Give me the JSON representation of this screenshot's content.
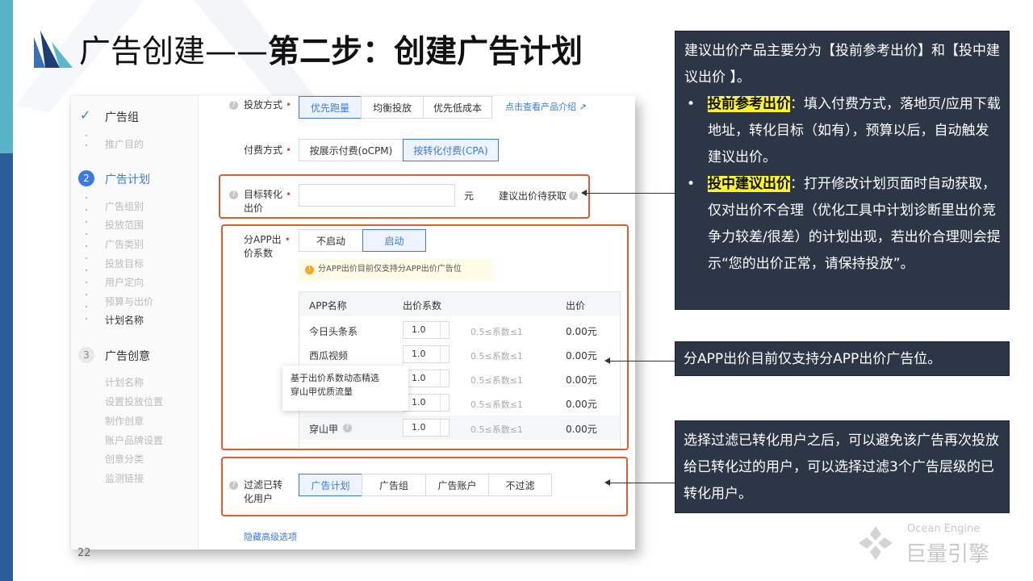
{
  "slide": {
    "title_normal": "广告创建——",
    "title_bold": "第二步：创建广告计划",
    "page_number": "22",
    "brand_en": "Ocean Engine",
    "brand_cn": "巨量引擎"
  },
  "sidebar": {
    "step1": {
      "label": "广告组",
      "sub": [
        "推广目的"
      ]
    },
    "step2": {
      "num": "2",
      "label": "广告计划",
      "sub": [
        "广告组别",
        "投放范围",
        "广告类别",
        "投放目标",
        "用户定向",
        "预算与出价",
        "计划名称"
      ]
    },
    "step3": {
      "num": "3",
      "label": "广告创意",
      "sub": [
        "计划名称",
        "设置投放位置",
        "制作创意",
        "账户品牌设置",
        "创意分类",
        "监测链接"
      ]
    }
  },
  "form": {
    "delivery_mode": {
      "label": "投放方式",
      "options": [
        "优先跑量",
        "均衡投放",
        "优先低成本"
      ],
      "selected": "优先跑量",
      "link": "点击查看产品介绍"
    },
    "pay_mode": {
      "label": "付费方式",
      "options": [
        "按展示付费(oCPM)",
        "按转化付费(CPA)"
      ],
      "selected": "按转化付费(CPA)"
    },
    "target_bid": {
      "label_line1": "目标转化",
      "label_line2": "出价",
      "value": "",
      "unit": "元",
      "suggest": "建议出价待获取"
    },
    "app_bid": {
      "label_line1": "分APP出",
      "label_line2": "价系数",
      "options": [
        "不启动",
        "启动"
      ],
      "selected": "启动",
      "notice": "分APP出价目前仅支持分APP出价广告位",
      "columns": [
        "APP名称",
        "出价系数",
        "出价"
      ],
      "rows": [
        {
          "app": "今日头条系",
          "coef": "1.0",
          "range": "0.5≤系数≤1",
          "price": "0.00元"
        },
        {
          "app": "西瓜视频",
          "coef": "1.0",
          "range": "0.5≤系数≤1",
          "price": "0.00元"
        },
        {
          "app": "",
          "coef": "1.0",
          "range": "0.5≤系数≤1",
          "price": "0.00元"
        },
        {
          "app": "",
          "coef": "1.0",
          "range": "0.5≤系数≤1",
          "price": "0.00元"
        },
        {
          "app": "穿山甲",
          "coef": "1.0",
          "range": "0.5≤系数≤1",
          "price": "0.00元"
        }
      ],
      "tooltip_line1": "基于出价系数动态精选",
      "tooltip_line2": "穿山甲优质流量"
    },
    "filter": {
      "label_line1": "过滤已转",
      "label_line2": "化用户",
      "options": [
        "广告计划",
        "广告组",
        "广告账户",
        "不过滤"
      ],
      "selected": "广告计划"
    },
    "advanced_link": "隐藏高级选项"
  },
  "notes": {
    "note1": {
      "intro": "建议出价产品主要分为【投前参考出价】和【投中建议出价 】。",
      "b1_key": "投前参考出价",
      "b1_text": "：填入付费方式，落地页/应用下载地址，转化目标（如有），预算以后，自动触发建议出价。",
      "b2_key": "投中建议出价",
      "b2_text": "：打开修改计划页面时自动获取，仅对出价不合理（优化工具中计划诊断里出价竞争力较差/很差）的计划出现，若出价合理则会提示“您的出价正常，请保持投放”。"
    },
    "note2": "分APP出价目前仅支持分APP出价广告位。",
    "note3": "选择过滤已转化用户之后，可以避免该广告再次投放给已转化过的用户，可以选择过滤3个广告层级的已转化用户。"
  },
  "colors": {
    "accent": "#3a79e6",
    "highlight_box": "#e05b2f",
    "note_bg": "#2d3646",
    "yellow": "#f8f32b"
  }
}
